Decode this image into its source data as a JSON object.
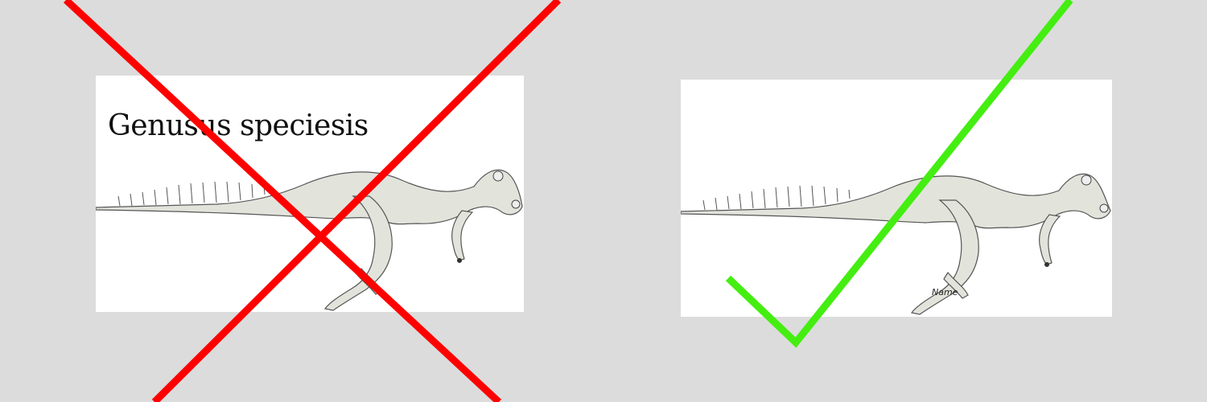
{
  "left_example": {
    "status": "incorrect",
    "caption": "Genusus speciesis",
    "mark_icon": "cross-icon",
    "mark_color": "#ff0000"
  },
  "right_example": {
    "status": "correct",
    "signature_text": "Name",
    "mark_icon": "checkmark-icon",
    "mark_color": "#44ee11"
  },
  "colors": {
    "background": "#dcdcdc",
    "panel": "#ffffff",
    "dinosaur_fill": "#e2e4dc",
    "dinosaur_outline": "#555555"
  }
}
